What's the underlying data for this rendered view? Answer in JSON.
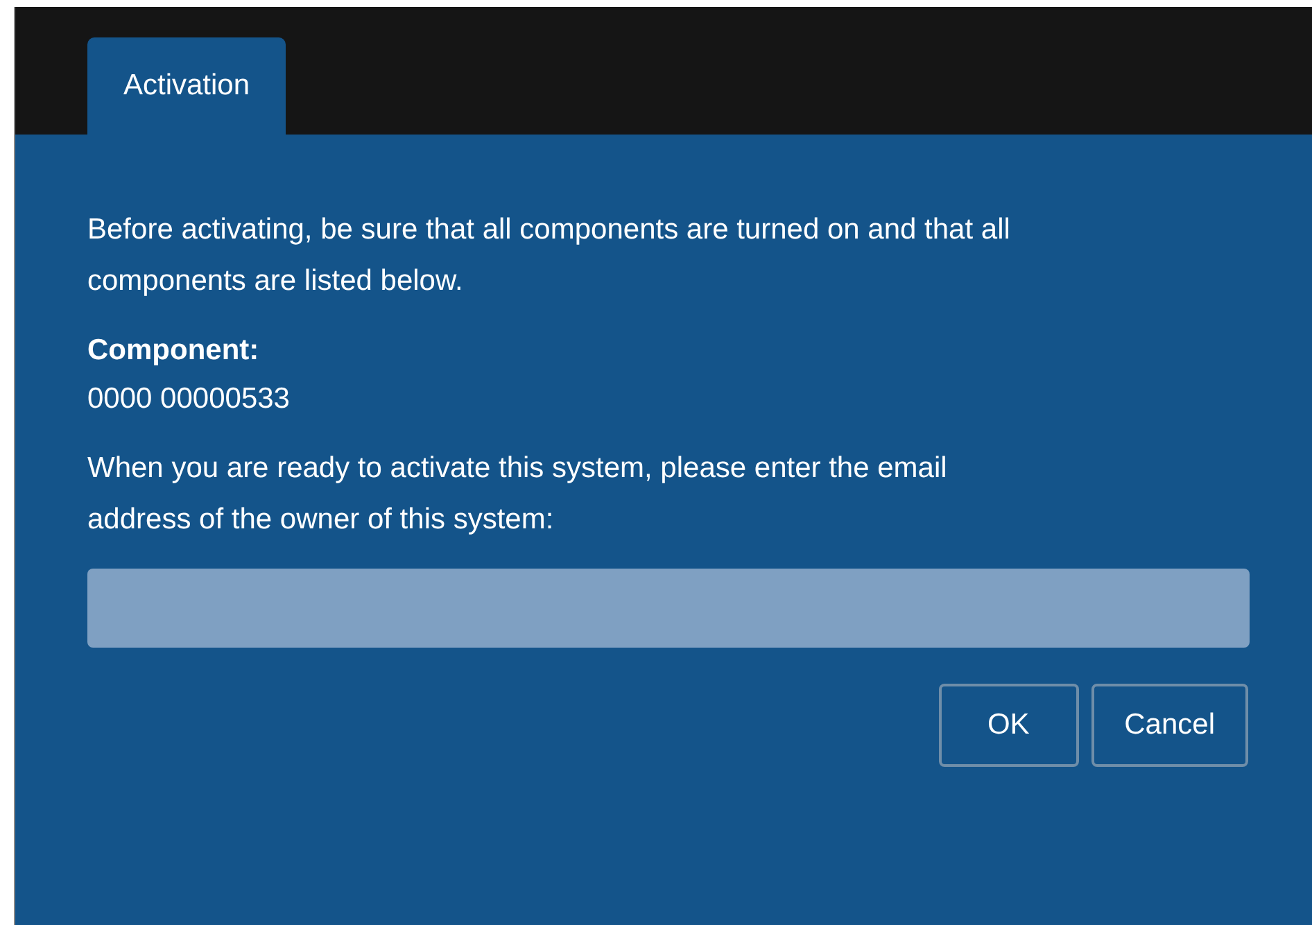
{
  "tabs": [
    {
      "label": "Activation",
      "selected": true
    }
  ],
  "intro": "Before activating, be sure that all components are turned on and that all components are listed below.",
  "component": {
    "label": "Component:",
    "value": "0000 00000533"
  },
  "prompt": "When you are ready to activate this system, please enter the email address of the owner of this system:",
  "buttons": [
    "OK",
    "Cancel"
  ]
}
